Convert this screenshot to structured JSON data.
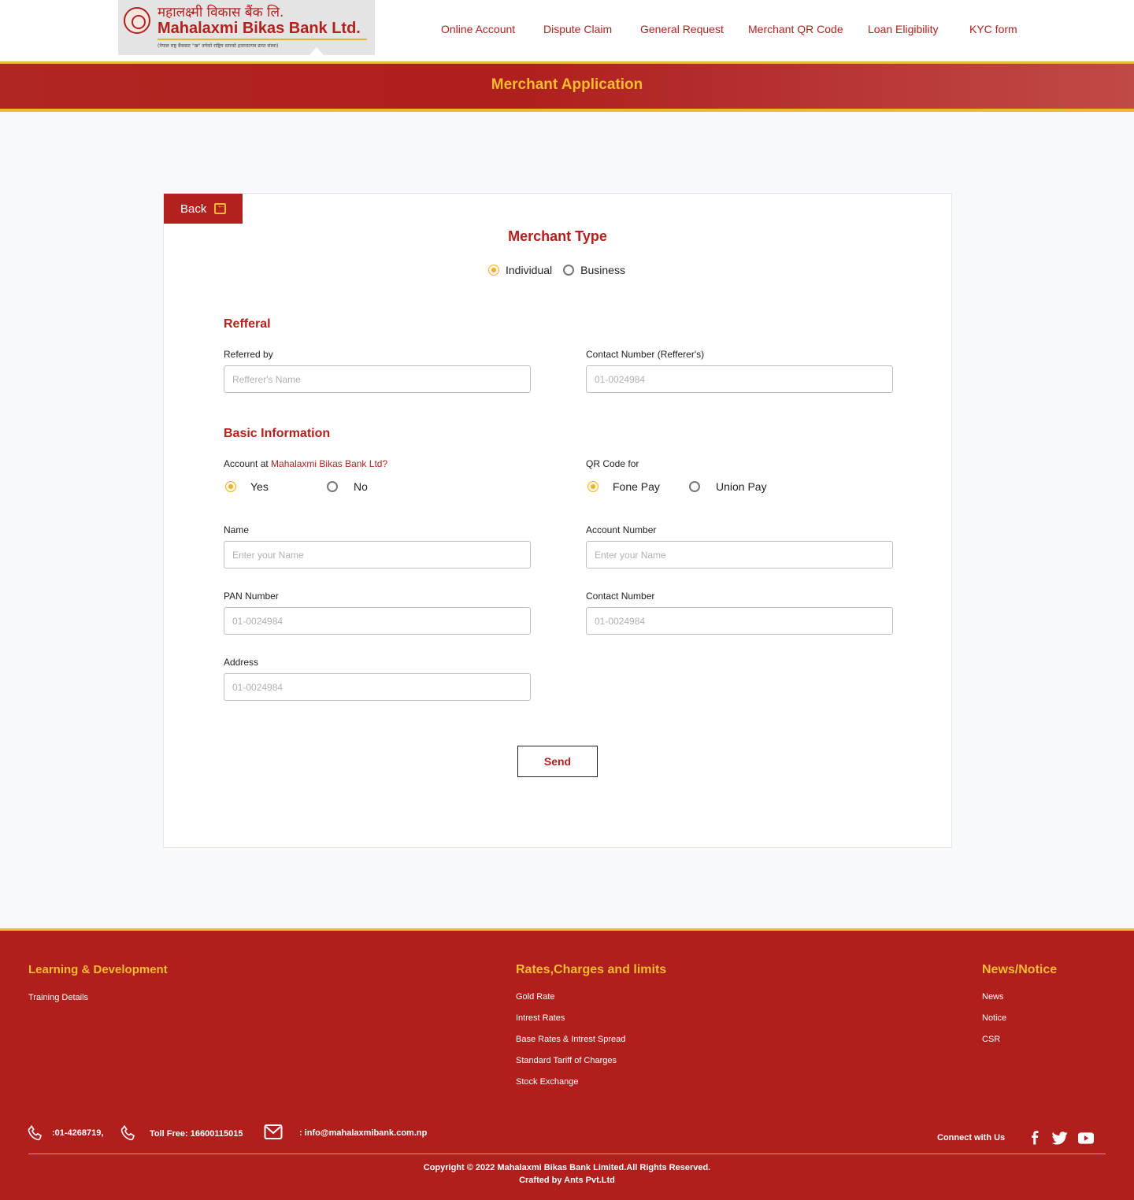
{
  "header": {
    "logo_nepali": "महालक्ष्मी विकास बैंक लि.",
    "logo_english": "Mahalaxmi Bikas Bank Ltd.",
    "logo_tagline": "(नेपाल राष्ट्र बैंकबाट \"ख\" वर्गको राष्ट्रिय स्तरको इजाजतपत्र प्राप्त संस्था)",
    "nav": [
      {
        "label": "Online Account"
      },
      {
        "label": "Dispute Claim"
      },
      {
        "label": "General Request"
      },
      {
        "label": "Merchant QR Code"
      },
      {
        "label": "Loan Eligibility"
      },
      {
        "label": "KYC form"
      }
    ]
  },
  "page_title": "Merchant Application",
  "form": {
    "back_label": "Back",
    "merchant_type": {
      "title": "Merchant Type",
      "options": [
        {
          "label": "Individual",
          "selected": true
        },
        {
          "label": "Business",
          "selected": false
        }
      ]
    },
    "referral": {
      "title": "Refferal",
      "referred_by_label": "Referred by",
      "referred_by_placeholder": "Refferer's Name",
      "contact_label": "Contact Number (Refferer's)",
      "contact_placeholder": "01-0024984"
    },
    "basic": {
      "title": "Basic Information",
      "account_question_prefix": "Account at ",
      "account_question_bank": "Mahalaxmi Bikas Bank Ltd?",
      "account_options": [
        {
          "label": "Yes",
          "selected": true
        },
        {
          "label": "No",
          "selected": false
        }
      ],
      "qr_label": "QR Code for",
      "qr_options": [
        {
          "label": "Fone Pay",
          "selected": true
        },
        {
          "label": "Union Pay",
          "selected": false
        }
      ],
      "name_label": "Name",
      "name_placeholder": "Enter your Name",
      "account_number_label": "Account Number",
      "account_number_placeholder": "Enter your Name",
      "pan_label": "PAN Number",
      "pan_placeholder": "01-0024984",
      "contact_label": "Contact Number",
      "contact_placeholder": "01-0024984",
      "address_label": "Address",
      "address_placeholder": "01-0024984"
    },
    "send_label": "Send"
  },
  "footer": {
    "learning": {
      "title": "Learning & Development",
      "links": [
        "Training Details"
      ]
    },
    "rates": {
      "title": "Rates,Charges and limits",
      "links": [
        "Gold Rate",
        "Intrest Rates",
        "Base Rates & Intrest Spread",
        "Standard Tariff of Charges",
        "Stock Exchange"
      ]
    },
    "news": {
      "title": "News/Notice",
      "links": [
        "News",
        "Notice",
        "CSR"
      ]
    },
    "phone": ":01-4268719,",
    "toll_free": "Toll Free: 16600115015",
    "email": ": info@mahalaxmibank.com.np",
    "connect_label": "Connect with Us",
    "copyright": "Copyright © 2022 Mahalaxmi Bikas Bank Limited.All Rights Reserved.",
    "crafted": "Crafted by Ants Pvt.Ltd"
  },
  "colors": {
    "brand_red": "#b3211e",
    "brand_gold": "#f0b731",
    "background": "#f8f9fc"
  }
}
